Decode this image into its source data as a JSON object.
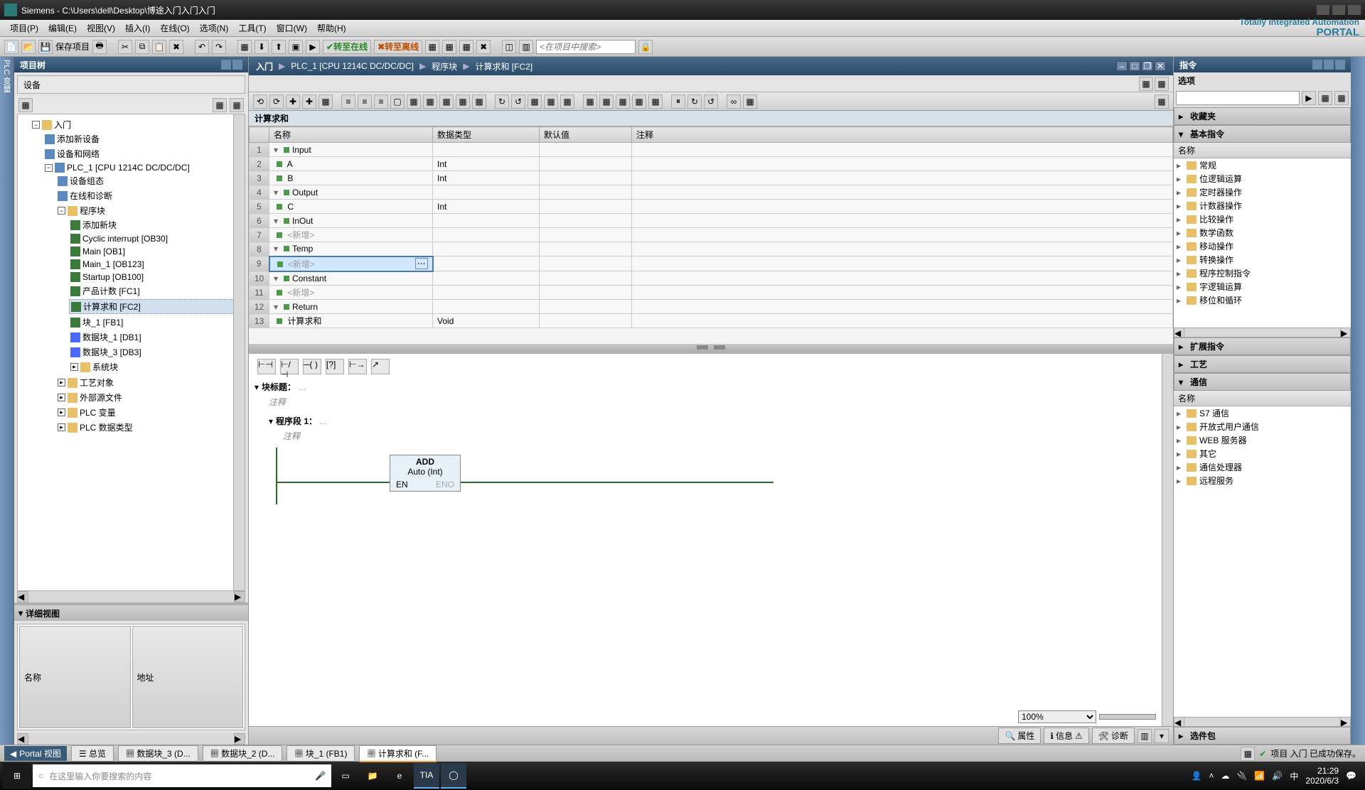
{
  "title": "Siemens  -  C:\\Users\\dell\\Desktop\\博途入门入门入门",
  "menu": [
    "项目(P)",
    "编辑(E)",
    "视图(V)",
    "插入(I)",
    "在线(O)",
    "选项(N)",
    "工具(T)",
    "窗口(W)",
    "帮助(H)"
  ],
  "brand": {
    "line1": "Totally Integrated Automation",
    "line2": "PORTAL"
  },
  "toolbar": {
    "save": "保存项目",
    "go": "转至在线",
    "stop": "转至离线",
    "search_ph": "<在项目中搜索>"
  },
  "left_side_tab": "PLC 变量",
  "project_tree": {
    "header": "项目树",
    "device_tab": "设备",
    "root": "入门",
    "items": [
      "添加新设备",
      "设备和网络",
      {
        "name": "PLC_1 [CPU 1214C DC/DC/DC]",
        "children": [
          "设备组态",
          "在线和诊断",
          {
            "name": "程序块",
            "children": [
              "添加新块",
              "Cyclic interrupt [OB30]",
              "Main [OB1]",
              "Main_1 [OB123]",
              "Startup [OB100]",
              "产品计数 [FC1]",
              {
                "name": "计算求和 [FC2]",
                "sel": true
              },
              "块_1 [FB1]",
              "数据块_1 [DB1]",
              "数据块_3 [DB3]",
              "系统块"
            ]
          },
          "工艺对象",
          "外部源文件",
          "PLC 变量",
          "PLC 数据类型"
        ]
      }
    ]
  },
  "detail": {
    "header": "详细视图",
    "cols": [
      "名称",
      "地址"
    ]
  },
  "breadcrumb": [
    "入门",
    "PLC_1 [CPU 1214C DC/DC/DC]",
    "程序块",
    "计算求和 [FC2]"
  ],
  "block_title": "计算求和",
  "iface": {
    "cols": [
      "",
      "名称",
      "数据类型",
      "默认值",
      "注释"
    ],
    "rows": [
      {
        "n": 1,
        "name": "Input",
        "type": "",
        "group": true
      },
      {
        "n": 2,
        "name": "A",
        "type": "Int"
      },
      {
        "n": 3,
        "name": "B",
        "type": "Int"
      },
      {
        "n": 4,
        "name": "Output",
        "type": "",
        "group": true
      },
      {
        "n": 5,
        "name": "C",
        "type": "Int"
      },
      {
        "n": 6,
        "name": "InOut",
        "type": "",
        "group": true
      },
      {
        "n": 7,
        "name": "<新增>",
        "type": "",
        "ph": true
      },
      {
        "n": 8,
        "name": "Temp",
        "type": "",
        "group": true
      },
      {
        "n": 9,
        "name": "<新增>",
        "type": "",
        "ph": true,
        "sel": true
      },
      {
        "n": 10,
        "name": "Constant",
        "type": "",
        "group": true
      },
      {
        "n": 11,
        "name": "<新增>",
        "type": "",
        "ph": true
      },
      {
        "n": 12,
        "name": "Return",
        "type": "",
        "group": true
      },
      {
        "n": 13,
        "name": "计算求和",
        "type": "Void"
      }
    ]
  },
  "net": {
    "block_title": "块标题：",
    "block_title_ph": "...",
    "comment": "注释",
    "seg_title": "程序段 1：",
    "seg_title_ph": "...",
    "add": {
      "name": "ADD",
      "sub": "Auto (Int)",
      "en": "EN",
      "eno": "ENO"
    },
    "zoom": "100%"
  },
  "bottom_tabs": {
    "prop": "属性",
    "info": "信息",
    "diag": "诊断"
  },
  "right": {
    "header": "指令",
    "options": "选项",
    "sections": [
      "收藏夹",
      "基本指令",
      "扩展指令",
      "工艺",
      "通信"
    ],
    "col": "名称",
    "basic": [
      "常规",
      "位逻辑运算",
      "定时器操作",
      "计数器操作",
      "比较操作",
      "数学函数",
      "移动操作",
      "转换操作",
      "程序控制指令",
      "字逻辑运算",
      "移位和循环"
    ],
    "comm": [
      "S7 通信",
      "开放式用户通信",
      "WEB 服务器",
      "其它",
      "通信处理器",
      "远程服务"
    ],
    "toolbox": "选件包"
  },
  "status": {
    "portal": "Portal 视图",
    "overview": "总览",
    "tabs": [
      "数据块_3 (D...",
      "数据块_2 (D...",
      "块_1 (FB1)",
      "计算求和 (F..."
    ],
    "msg": "项目 入门 已成功保存。"
  },
  "taskbar": {
    "search_ph": "在这里输入你要搜索的内容",
    "time": "21:29",
    "date": "2020/6/3"
  }
}
